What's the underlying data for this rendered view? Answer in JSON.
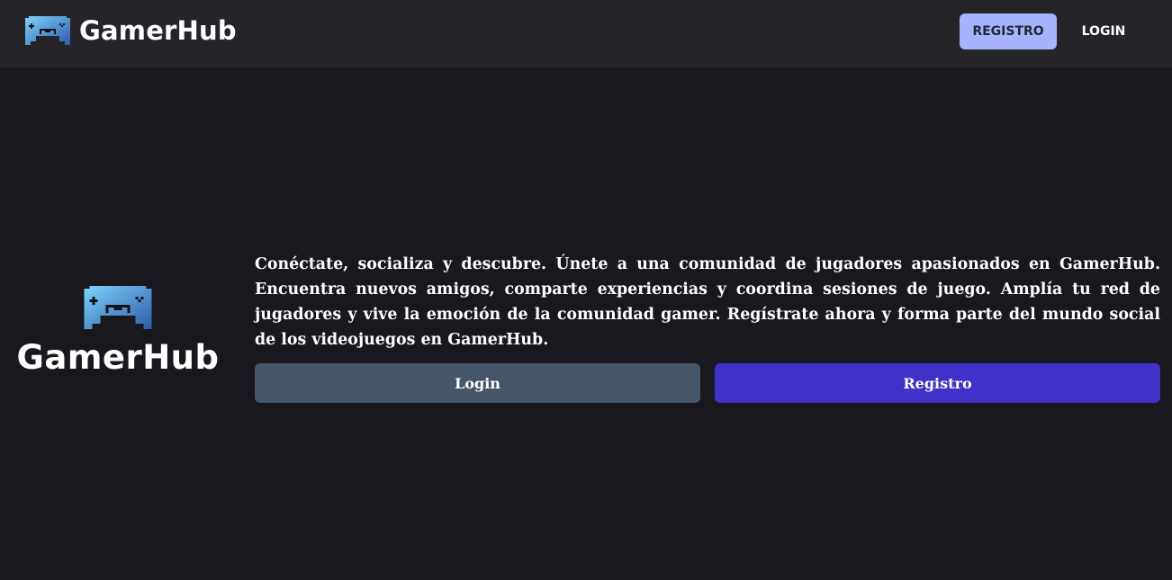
{
  "header": {
    "brand_name": "GamerHub",
    "brand_icon": "gamepad-icon",
    "registro_label": "REGISTRO",
    "login_label": "LOGIN"
  },
  "hero": {
    "brand_name": "GamerHub",
    "brand_icon": "gamepad-icon",
    "description": "Conéctate, socializa y descubre. Únete a una comunidad de jugadores apasionados en GamerHub. Encuentra nuevos amigos, comparte experiencias y coordina sesiones de juego. Amplía tu red de jugadores y vive la emoción de la comunidad gamer. Regístrate ahora y forma parte del mundo social de los videojuegos en GamerHub.",
    "login_label": "Login",
    "registro_label": "Registro"
  },
  "colors": {
    "background": "#18181e",
    "navbar": "#242429",
    "nav_registro_bg": "#a5b4fc",
    "login_button": "#475569",
    "registro_button": "#4032c8",
    "logo_light": "#7dd3fc",
    "logo_dark": "#2f5aa8"
  }
}
